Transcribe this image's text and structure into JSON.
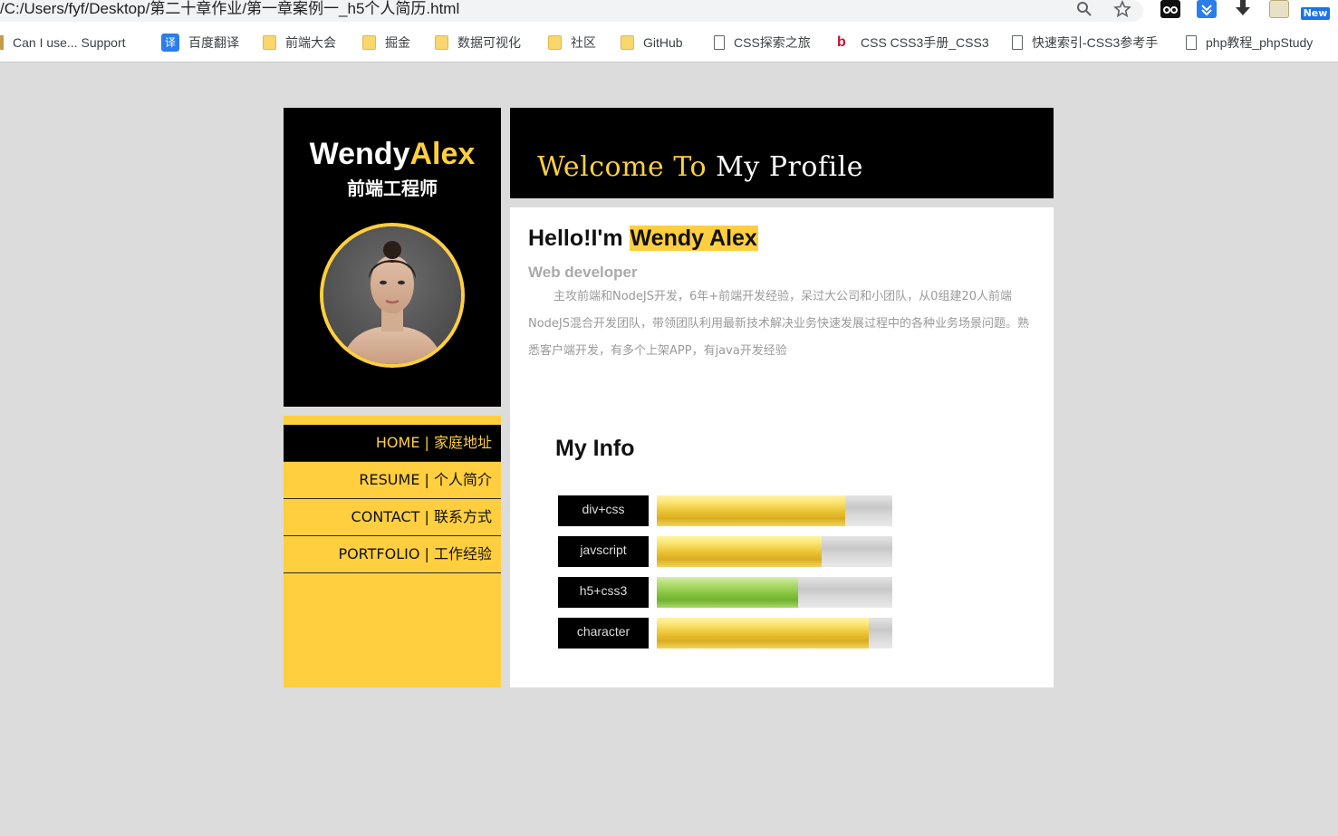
{
  "browser": {
    "address": "/C:/Users/fyf/Desktop/第二十章作业/第一章案例一_h5个人简历.html",
    "new_badge": "New",
    "bookmarks": [
      {
        "label": "Can I use... Support",
        "icon": "caniuse-icon"
      },
      {
        "label": "百度翻译",
        "icon": "fanyi-icon",
        "glyph": "译"
      },
      {
        "label": "前端大会",
        "icon": "folder-icon"
      },
      {
        "label": "掘金",
        "icon": "folder-icon"
      },
      {
        "label": "数据可视化",
        "icon": "folder-icon"
      },
      {
        "label": "社区",
        "icon": "folder-icon"
      },
      {
        "label": "GitHub",
        "icon": "folder-icon"
      },
      {
        "label": "CSS探索之旅",
        "icon": "page-icon"
      },
      {
        "label": "CSS CSS3手册_CSS3",
        "icon": "brand-icon",
        "glyph": "b"
      },
      {
        "label": "快速索引-CSS3参考手",
        "icon": "page-icon"
      },
      {
        "label": "php教程_phpStudy",
        "icon": "page-icon"
      }
    ]
  },
  "sidebar": {
    "name_first": "Wendy",
    "name_last": "Alex",
    "role": "前端工程师",
    "nav": [
      {
        "label": "HOME | 家庭地址",
        "active": true
      },
      {
        "label": "RESUME | 个人简介",
        "active": false
      },
      {
        "label": "CONTACT | 联系方式",
        "active": false
      },
      {
        "label": "PORTFOLIO | 工作经验",
        "active": false
      }
    ]
  },
  "header": {
    "welcome_part1": "Welcome To",
    "welcome_part2": " My Profile"
  },
  "main": {
    "hello_prefix": "Hello!I'm ",
    "hello_name": "Wendy Alex",
    "subtitle": "Web developer",
    "intro": "主攻前端和NodeJS开发，6年+前端开发经验，呆过大公司和小团队，从0组建20人前端NodeJS混合开发团队，带领团队利用最新技术解决业务快速发展过程中的各种业务场景问题。熟悉客户端开发，有多个上架APP，有java开发经验",
    "info_title": "My Info",
    "skills": [
      {
        "name": "div+css",
        "level": 0.8,
        "color": "yellow"
      },
      {
        "name": "javscript",
        "level": 0.7,
        "color": "yellow"
      },
      {
        "name": "h5+css3",
        "level": 0.6,
        "color": "green"
      },
      {
        "name": "character",
        "level": 0.9,
        "color": "yellow"
      }
    ]
  },
  "colors": {
    "accent": "#ffcf3f",
    "background": "#dcdcdc",
    "panel_dark": "#000000"
  }
}
